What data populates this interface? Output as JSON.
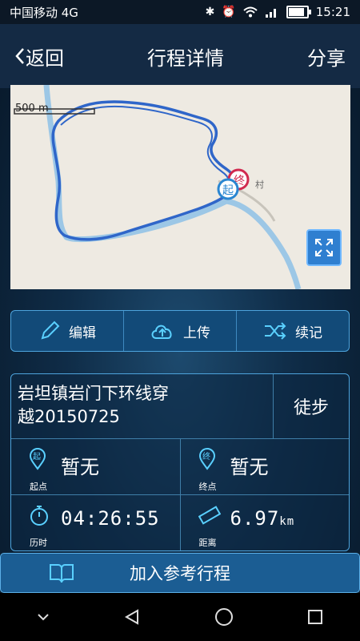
{
  "status": {
    "carrier": "中国移动 4G",
    "time": "15:21"
  },
  "header": {
    "back_label": "返回",
    "title": "行程详情",
    "share_label": "分享"
  },
  "map": {
    "scale_label": "500 m",
    "start_marker": "起",
    "end_marker": "终",
    "village_label": "村"
  },
  "actions": {
    "edit": "编辑",
    "upload": "上传",
    "continue": "续记"
  },
  "trip": {
    "name_line1": "岩坦镇岩门下环线穿",
    "name_line2": "越20150725",
    "type": "徒步",
    "start_value": "暂无",
    "start_label": "起点",
    "end_value": "暂无",
    "end_label": "终点",
    "duration_value": "04:26:55",
    "duration_label": "历时",
    "distance_value": "6.97",
    "distance_unit": "km",
    "distance_label": "距离",
    "start_icon_text": "起",
    "end_icon_text": "终"
  },
  "footer": {
    "add_label": "加入参考行程"
  }
}
